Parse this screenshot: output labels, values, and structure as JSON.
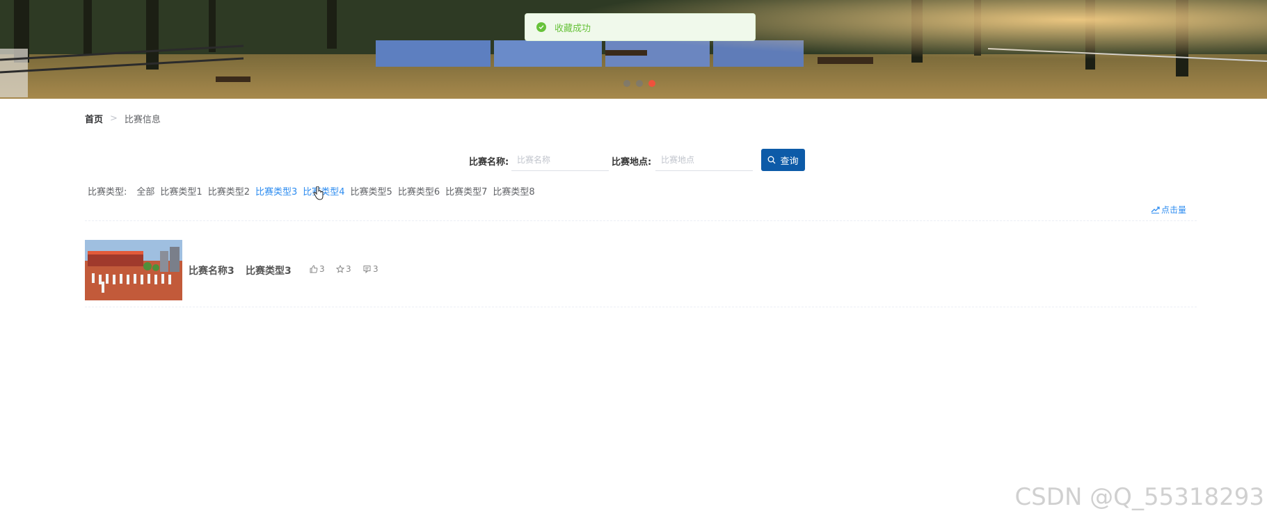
{
  "toast": {
    "message": "收藏成功"
  },
  "breadcrumb": {
    "home": "首页",
    "separator": ">",
    "current": "比赛信息"
  },
  "search": {
    "name_label": "比赛名称:",
    "name_placeholder": "比赛名称",
    "location_label": "比赛地点:",
    "location_placeholder": "比赛地点",
    "button_label": "查询"
  },
  "filters": {
    "label": "比赛类型:",
    "types": [
      "全部",
      "比赛类型1",
      "比赛类型2",
      "比赛类型3",
      "比赛类型4",
      "比赛类型5",
      "比赛类型6",
      "比赛类型7",
      "比赛类型8"
    ],
    "active": "比赛类型3",
    "hovered": "比赛类型4"
  },
  "sort": {
    "label": "点击量"
  },
  "items": [
    {
      "name": "比赛名称3",
      "type": "比赛类型3",
      "likes": "3",
      "favorites": "3",
      "comments": "3"
    }
  ],
  "carousel": {
    "slides": 3,
    "active_index": 2
  },
  "watermark": "CSDN @Q_55318293",
  "colors": {
    "primary": "#0d5ba8",
    "link": "#2d8cf0",
    "success": "#67c23a",
    "dot_active": "#f0513c"
  }
}
